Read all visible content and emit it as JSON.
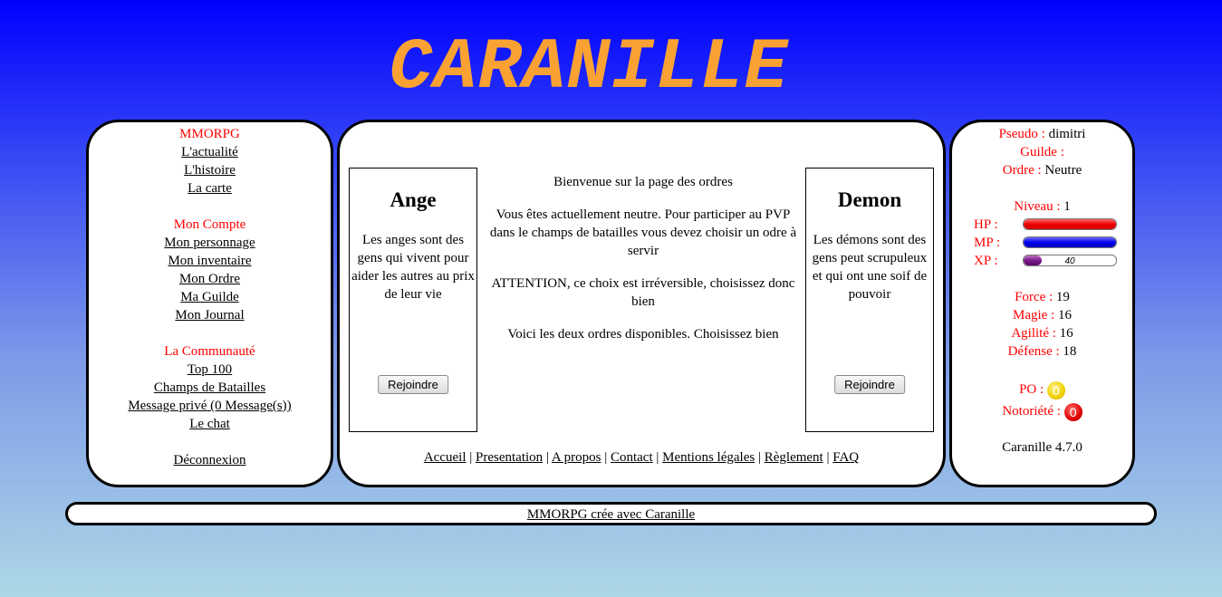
{
  "site": {
    "logo": "CARANILLE"
  },
  "left_menu": {
    "section1_title": "MMORPG",
    "section1_items": [
      "L'actualité",
      "L'histoire",
      "La carte"
    ],
    "section2_title": "Mon Compte",
    "section2_items": [
      "Mon personnage",
      "Mon inventaire",
      "Mon Ordre",
      "Ma Guilde",
      "Mon Journal"
    ],
    "section3_title": "La Communauté",
    "section3_items": [
      "Top 100",
      "Champs de Batailles",
      "Message privé (0 Message(s))",
      "Le chat"
    ],
    "logout": "Déconnexion"
  },
  "main": {
    "ange": {
      "title": "Ange",
      "desc": "Les anges sont des gens qui vivent pour aider les autres au prix de leur vie",
      "button": "Rejoindre"
    },
    "demon": {
      "title": "Demon",
      "desc": "Les démons sont des gens peut scrupuleux et qui ont une soif de pouvoir",
      "button": "Rejoindre"
    },
    "intro": "Bienvenue sur la page des ordres",
    "status": "Vous êtes actuellement neutre. Pour participer au PVP dans le champs de batailles vous devez choisir un odre à servir",
    "warning": "ATTENTION, ce choix est irréversible, choisissez donc bien",
    "choose": "Voici les deux ordres disponibles. Choisissez bien",
    "links": [
      "Accueil",
      "Presentation",
      "A propos",
      "Contact",
      "Mentions légales",
      "Règlement",
      "FAQ"
    ],
    "separator": "|"
  },
  "player": {
    "pseudo_label": "Pseudo :",
    "pseudo": "dimitri",
    "guild_label": "Guilde :",
    "guild": "",
    "order_label": "Ordre :",
    "order": "Neutre",
    "level_label": "Niveau :",
    "level": "1",
    "hp_label": "HP :",
    "hp_fraction": 1.0,
    "mp_label": "MP :",
    "mp_fraction": 1.0,
    "xp_label": "XP :",
    "xp_text": "40",
    "xp_fraction": 0.2,
    "force_label": "Force :",
    "force": "19",
    "magie_label": "Magie :",
    "magie": "16",
    "agilite_label": "Agilité :",
    "agilite": "16",
    "defense_label": "Défense :",
    "defense": "18",
    "po_label": "PO :",
    "po": "0",
    "noto_label": "Notoriété :",
    "noto": "0",
    "version": "Caranille 4.7.0"
  },
  "footer": {
    "text": "MMORPG crée avec Caranille"
  },
  "colors": {
    "logo": "#f9a233",
    "label_red": "#ff0000",
    "hp": "#ee0000",
    "mp": "#0000ee",
    "xp": "#7a1a8a",
    "gold": "#f0d000",
    "fame": "#e00000"
  }
}
